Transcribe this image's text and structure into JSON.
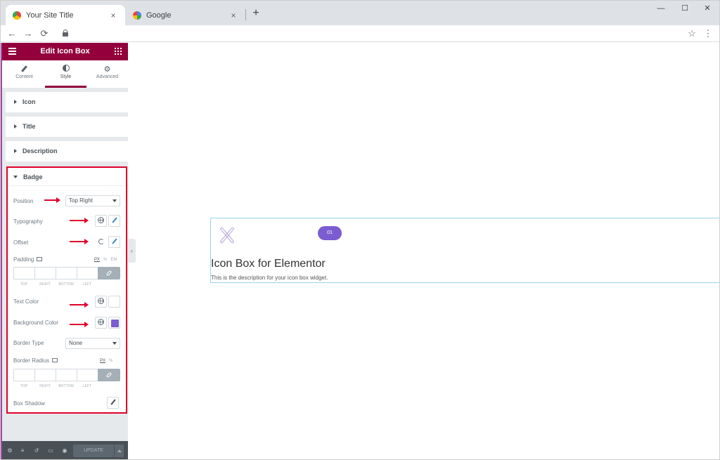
{
  "browser": {
    "tabs": [
      {
        "title": "Your Site Title",
        "favicon": "chrome-icon"
      },
      {
        "title": "Google",
        "favicon": "google-icon"
      }
    ],
    "close_glyph": "×",
    "newtab_glyph": "+",
    "window": {
      "minimize": "—",
      "maximize": "☐",
      "close": "✕"
    },
    "nav": {
      "back": "←",
      "forward": "→",
      "reload": "⟳"
    },
    "star_glyph": "☆",
    "menu_glyph": "⋮"
  },
  "panel": {
    "title": "Edit Icon Box",
    "tabs": [
      {
        "label": "Content",
        "icon": "pencil-icon"
      },
      {
        "label": "Style",
        "icon": "contrast-icon"
      },
      {
        "label": "Advanced",
        "icon": "gear-icon"
      }
    ],
    "gear_glyph": "⚙",
    "sections": [
      {
        "label": "Icon"
      },
      {
        "label": "Title"
      },
      {
        "label": "Description"
      }
    ],
    "badge": {
      "title": "Badge",
      "position": {
        "label": "Position",
        "value": "Top Right"
      },
      "typography": {
        "label": "Typography"
      },
      "offset": {
        "label": "Offset"
      },
      "padding": {
        "label": "Padding",
        "units": [
          "PX",
          "%",
          "EM"
        ],
        "sides": [
          "TOP",
          "RIGHT",
          "BOTTOM",
          "LEFT"
        ]
      },
      "text_color": {
        "label": "Text Color"
      },
      "background_color": {
        "label": "Background Color",
        "value": "#7b5cd1"
      },
      "border_type": {
        "label": "Border Type",
        "value": "None"
      },
      "border_radius": {
        "label": "Border Radius",
        "units": [
          "PX",
          "%"
        ],
        "sides": [
          "TOP",
          "RIGHT",
          "BOTTOM",
          "LEFT"
        ]
      },
      "box_shadow": {
        "label": "Box Shadow"
      }
    },
    "footer": {
      "update": "UPDATE",
      "icons": [
        "⚙",
        "≡",
        "↺",
        "▭",
        "◉"
      ]
    },
    "collapse_glyph": "‹"
  },
  "canvas": {
    "badge_text": "01",
    "badge_color": "#7b5cd1",
    "title": "Icon Box for Elementor",
    "description": "This is the description for your icon box widget."
  },
  "colors": {
    "panel_header": "#93003c",
    "highlight_red": "#e0002a",
    "accent_purple": "#7b5cd1"
  }
}
